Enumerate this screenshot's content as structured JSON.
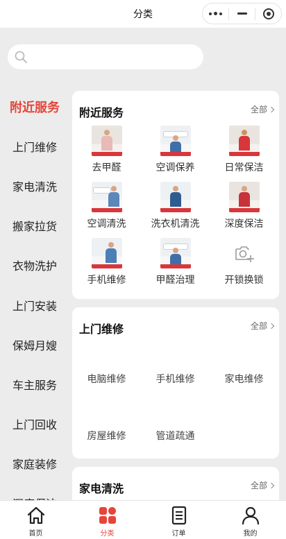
{
  "header": {
    "title": "分类"
  },
  "search": {
    "placeholder": ""
  },
  "sidebar": {
    "items": [
      {
        "label": "附近服务",
        "active": true
      },
      {
        "label": "上门维修"
      },
      {
        "label": "家电清洗"
      },
      {
        "label": "搬家拉货"
      },
      {
        "label": "衣物洗护"
      },
      {
        "label": "上门安装"
      },
      {
        "label": "保姆月嫂"
      },
      {
        "label": "车主服务"
      },
      {
        "label": "上门回收"
      },
      {
        "label": "家庭装修"
      },
      {
        "label": "深度保洁"
      }
    ]
  },
  "sections": {
    "nearby": {
      "title": "附近服务",
      "more": "全部",
      "items": [
        {
          "label": "去甲醛"
        },
        {
          "label": "空调保养"
        },
        {
          "label": "日常保洁"
        },
        {
          "label": "空调清洗"
        },
        {
          "label": "洗衣机清洗"
        },
        {
          "label": "深度保洁"
        },
        {
          "label": "手机维修"
        },
        {
          "label": "甲醛治理"
        },
        {
          "label": "开锁换锁",
          "icon": "camera-icon"
        }
      ]
    },
    "repair": {
      "title": "上门维修",
      "more": "全部",
      "items": [
        {
          "label": "电脑维修"
        },
        {
          "label": "手机维修"
        },
        {
          "label": "家电维修"
        },
        {
          "label": "房屋维修"
        },
        {
          "label": "管道疏通"
        }
      ]
    },
    "cleaning": {
      "title": "家电清洗",
      "more": "全部"
    }
  },
  "tabbar": {
    "items": [
      {
        "label": "首页",
        "icon": "home-icon"
      },
      {
        "label": "分类",
        "icon": "category-icon",
        "active": true
      },
      {
        "label": "订单",
        "icon": "order-icon"
      },
      {
        "label": "我的",
        "icon": "user-icon"
      }
    ]
  },
  "colors": {
    "accent": "#e5453a",
    "background": "#ececec",
    "card": "#ffffff"
  }
}
